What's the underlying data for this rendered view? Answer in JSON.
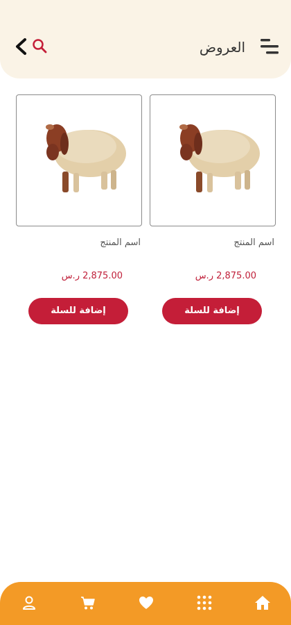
{
  "header": {
    "title": "العروض",
    "icons": {
      "back": "chevron-left-icon",
      "search": "search-icon",
      "menu": "menu-lines-icon"
    }
  },
  "products": [
    {
      "name": "اسم المنتج",
      "price": "2,875.00 ر.س",
      "button_label": "إضافة للسلة",
      "image": "sheep-image"
    },
    {
      "name": "اسم المنتج",
      "price": "2,875.00 ر.س",
      "button_label": "إضافة للسلة",
      "image": "sheep-image"
    }
  ],
  "bottom_nav": {
    "items": [
      {
        "icon": "user-icon"
      },
      {
        "icon": "cart-icon"
      },
      {
        "icon": "heart-icon"
      },
      {
        "icon": "grid-icon"
      },
      {
        "icon": "home-icon"
      }
    ]
  },
  "colors": {
    "header_bg": "#faf3e6",
    "accent": "#c41e38",
    "nav_bg": "#f39a26",
    "price": "#c0203a"
  }
}
